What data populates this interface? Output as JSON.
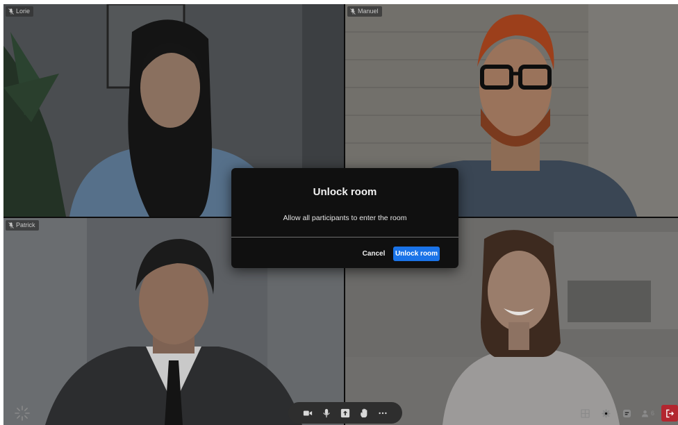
{
  "participants": [
    {
      "name": "Lorie"
    },
    {
      "name": "Manuel"
    },
    {
      "name": "Patrick"
    },
    {
      "name": ""
    }
  ],
  "modal": {
    "title": "Unlock room",
    "message": "Allow all participants to enter the room",
    "cancel_label": "Cancel",
    "confirm_label": "Unlock room"
  },
  "toolbar": {
    "icons": [
      "camera-icon",
      "microphone-icon",
      "share-screen-icon",
      "raise-hand-icon",
      "more-icon"
    ]
  },
  "right_tools": {
    "icons": [
      "grid-layout-icon",
      "settings-icon",
      "chat-icon",
      "participants-icon",
      "leave-icon"
    ],
    "participant_count": "6"
  },
  "colors": {
    "accent": "#1a73e8",
    "leave": "#b3262f",
    "modal_bg": "#101010",
    "toolbar_bg": "#2e2e2e"
  }
}
